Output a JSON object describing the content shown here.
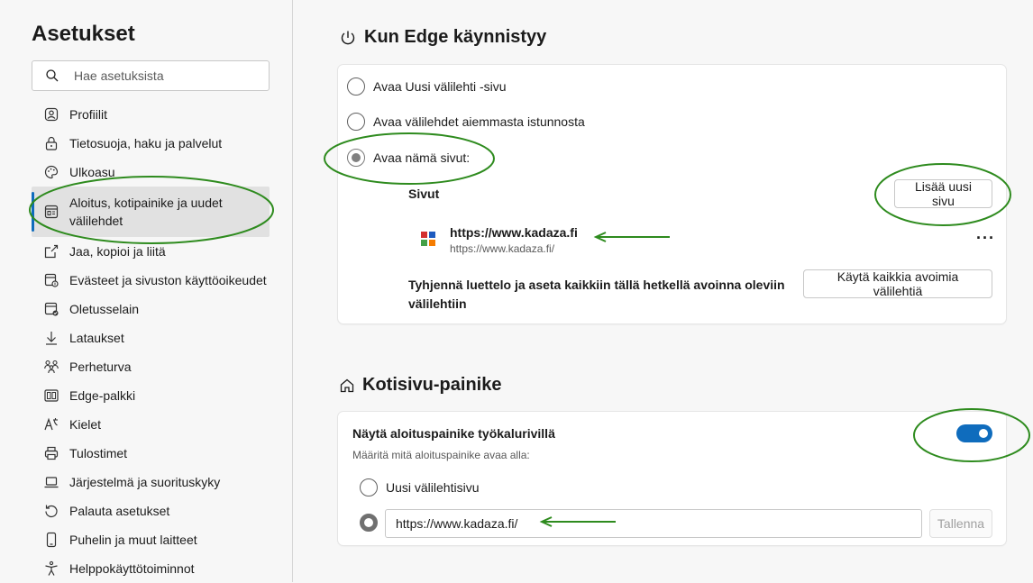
{
  "sidebar": {
    "title": "Asetukset",
    "search_placeholder": "Hae asetuksista",
    "items": [
      {
        "label": "Profiilit",
        "icon": "profile-icon"
      },
      {
        "label": "Tietosuoja, haku ja palvelut",
        "icon": "lock-icon"
      },
      {
        "label": "Ulkoasu",
        "icon": "palette-icon"
      },
      {
        "label": "Aloitus, kotipainike ja uudet välilehdet",
        "icon": "start-page-icon",
        "active": true
      },
      {
        "label": "Jaa, kopioi ja liitä",
        "icon": "share-icon"
      },
      {
        "label": "Evästeet ja sivuston käyttöoikeudet",
        "icon": "cookies-icon"
      },
      {
        "label": "Oletusselain",
        "icon": "default-browser-icon"
      },
      {
        "label": "Lataukset",
        "icon": "download-icon"
      },
      {
        "label": "Perheturva",
        "icon": "family-icon"
      },
      {
        "label": "Edge-palkki",
        "icon": "edge-bar-icon"
      },
      {
        "label": "Kielet",
        "icon": "languages-icon"
      },
      {
        "label": "Tulostimet",
        "icon": "printer-icon"
      },
      {
        "label": "Järjestelmä ja suorituskyky",
        "icon": "laptop-icon"
      },
      {
        "label": "Palauta asetukset",
        "icon": "reset-icon"
      },
      {
        "label": "Puhelin ja muut laitteet",
        "icon": "phone-icon"
      },
      {
        "label": "Helppokäyttötoiminnot",
        "icon": "accessibility-icon"
      }
    ]
  },
  "startup": {
    "title": "Kun Edge käynnistyy",
    "options": [
      {
        "label": "Avaa Uusi välilehti -sivu",
        "selected": false
      },
      {
        "label": "Avaa välilehdet aiemmasta istunnosta",
        "selected": false
      },
      {
        "label": "Avaa nämä sivut:",
        "selected": true
      }
    ],
    "pages_heading": "Sivut",
    "add_page_button": "Lisää uusi sivu",
    "page_entry": {
      "title": "https://www.kadaza.fi",
      "url": "https://www.kadaza.fi/"
    },
    "more_label": "···",
    "clear_text": "Tyhjennä luettelo ja aseta kaikkiin tällä hetkellä avoinna oleviin välilehtiin",
    "use_all_tabs_button": "Käytä kaikkia avoimia välilehtiä"
  },
  "home_button": {
    "title": "Kotisivu-painike",
    "show_label": "Näytä aloituspainike työkalurivillä",
    "show_enabled": true,
    "hint": "Määritä mitä aloituspainike avaa alla:",
    "new_tab_option": "Uusi välilehtisivu",
    "url_value": "https://www.kadaza.fi/",
    "save_button": "Tallenna"
  },
  "colors": {
    "accent": "#0f6cbd",
    "annotation": "#2e8b1e",
    "favicon": [
      "#d32f2f",
      "#1e5bbf",
      "#43a047",
      "#f57c00"
    ]
  }
}
